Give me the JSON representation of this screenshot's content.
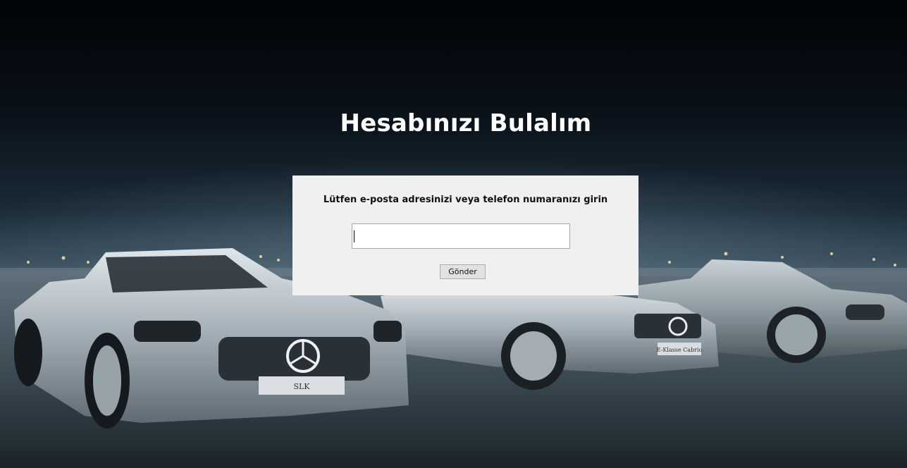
{
  "page": {
    "title": "Hesabınızı Bulalım"
  },
  "form": {
    "instruction": "Lütfen e-posta adresinizi veya telefon numaranızı girin",
    "input_value": "",
    "submit_label": "Gönder"
  },
  "background": {
    "badges": [
      "SLK",
      "E-Klasse Cabrio"
    ]
  },
  "colors": {
    "title": "#ffffff",
    "panel": "#f0f0f0",
    "sky": "#05090d",
    "car_silver": "#a9b3bb"
  }
}
